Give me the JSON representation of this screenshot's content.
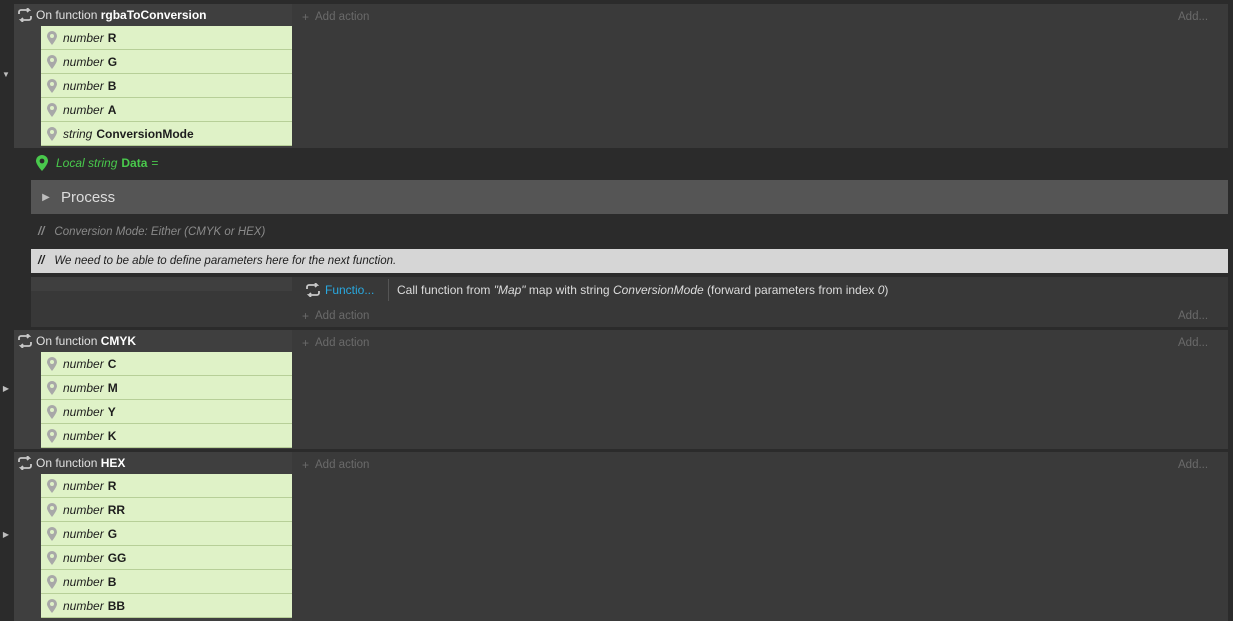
{
  "events": [
    {
      "prefix": "On function",
      "name": "rgbaToConversion",
      "params": [
        {
          "type": "number",
          "name": "R"
        },
        {
          "type": "number",
          "name": "G"
        },
        {
          "type": "number",
          "name": "B"
        },
        {
          "type": "number",
          "name": "A"
        },
        {
          "type": "string",
          "name": "ConversionMode"
        }
      ],
      "add_action": "Add action",
      "add_right": "Add..."
    },
    {
      "prefix": "On function",
      "name": "CMYK",
      "params": [
        {
          "type": "number",
          "name": "C"
        },
        {
          "type": "number",
          "name": "M"
        },
        {
          "type": "number",
          "name": "Y"
        },
        {
          "type": "number",
          "name": "K"
        }
      ],
      "add_action": "Add action",
      "add_right": "Add..."
    },
    {
      "prefix": "On function",
      "name": "HEX",
      "params": [
        {
          "type": "number",
          "name": "R"
        },
        {
          "type": "number",
          "name": "RR"
        },
        {
          "type": "number",
          "name": "G"
        },
        {
          "type": "number",
          "name": "GG"
        },
        {
          "type": "number",
          "name": "B"
        },
        {
          "type": "number",
          "name": "BB"
        }
      ],
      "add_action": "Add action",
      "add_right": "Add..."
    }
  ],
  "local_var": {
    "scope": "Local string",
    "name": "Data",
    "eq": "="
  },
  "group": {
    "name": "Process"
  },
  "comments": [
    {
      "slashes": "//",
      "text": "Conversion Mode: Either (CMYK or HEX)"
    },
    {
      "slashes": "//",
      "text": "We need to be able to define parameters here for the next function."
    }
  ],
  "sub_event": {
    "action_name": "Functio...",
    "desc_pre": "Call function from ",
    "desc_map": "\"Map\"",
    "desc_mid": " map with string ",
    "desc_var": "ConversionMode",
    "desc_post1": " (forward parameters from index ",
    "desc_index": "0",
    "desc_post2": ")",
    "add_action": "Add action",
    "add_right": "Add..."
  },
  "colors": {
    "param_bg": "#dff2c7",
    "function_blue": "#29a9e0",
    "local_green": "#49c94c"
  },
  "icons": {
    "loop": "loop-arrows-icon",
    "pin": "map-pin-icon",
    "collapse": "triangle-icon"
  }
}
